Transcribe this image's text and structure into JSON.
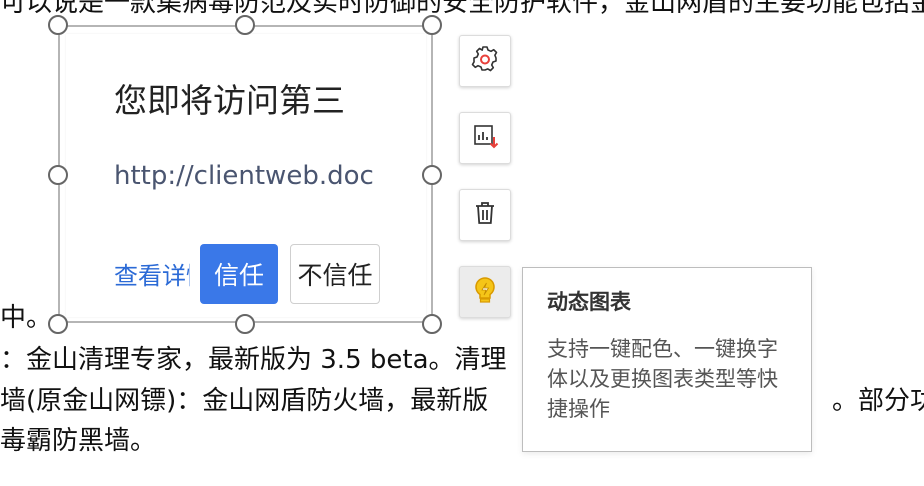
{
  "document": {
    "line_top": "可以说是一款集病毒防范及实时防御的安全防护软件，金山网盾的主要功能包括金山",
    "line_1": "中。",
    "line_2": "：金山清理专家，最新版为 3.5 beta。清理",
    "line_3": "墙(原金山网镖)：金山网盾防火墙，最新版",
    "line_3_right": "。部分功",
    "line_4": "毒霸防黑墙。"
  },
  "dialog_card": {
    "title": "您即将访问第三",
    "url": "http://clientweb.docer.wps.cn",
    "details_link": "查看详情",
    "trust_button": "信任",
    "distrust_button": "不信任"
  },
  "toolbar": {
    "items": [
      {
        "name": "settings",
        "icon": "gear-icon"
      },
      {
        "name": "export",
        "icon": "export-chart-icon"
      },
      {
        "name": "delete",
        "icon": "trash-icon"
      },
      {
        "name": "dynamic-chart",
        "icon": "lightbulb-icon",
        "active": true
      }
    ]
  },
  "tooltip": {
    "title": "动态图表",
    "description": "支持一键配色、一键换字体以及更换图表类型等快捷操作"
  },
  "colors": {
    "accent_blue": "#3a78e8",
    "link_blue": "#2b6ad6",
    "icon_red": "#e8403a",
    "icon_yellow": "#f5c518"
  }
}
